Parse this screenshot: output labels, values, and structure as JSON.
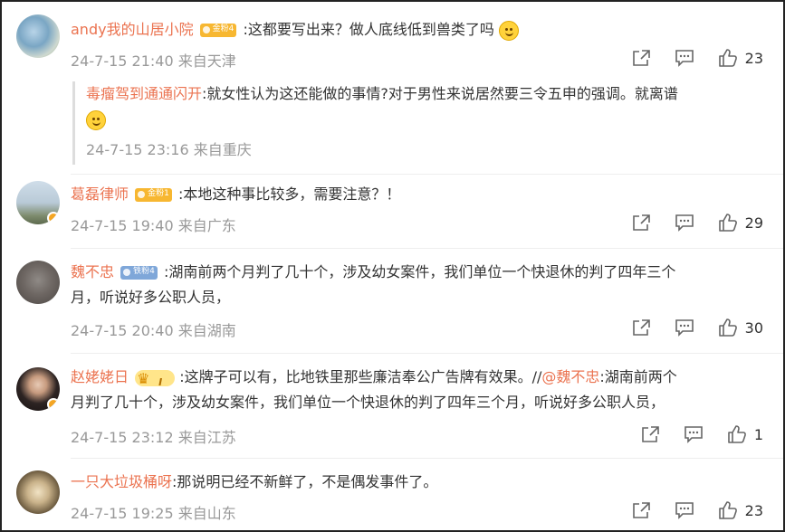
{
  "comments": [
    {
      "name": "andy我的山居小院",
      "badge": "金粉4",
      "text": ":这都要写出来？做人底线低到兽类了吗",
      "time": "24-7-15 21:40 来自天津",
      "likes": "23"
    },
    {
      "name": "毒瘤驾到通通闪开",
      "text": ":就女性认为这还能做的事情?对于男性来说居然要三令五申的强调。就离谱",
      "time": "24-7-15 23:16 来自重庆"
    },
    {
      "name": "葛磊律师",
      "badge": "金粉1",
      "text": ":本地这种事比较多，需要注意？！",
      "time": "24-7-15 19:40 来自广东",
      "likes": "29"
    },
    {
      "name": "魏不忠",
      "badge": "铁粉4",
      "text1": ":湖南前两个月判了几十个，涉及幼女案件，我们单位一个快退休的判了四年三个",
      "text2": "月，听说好多公职人员，",
      "time": "24-7-15 20:40 来自湖南",
      "likes": "30"
    },
    {
      "name": "赵姥姥日",
      "text1": ":这牌子可以有，比地铁里那些廉洁奉公广告牌有效果。//",
      "mention": "@魏不忠",
      "text1b": ":湖南前两个",
      "text2": "月判了几十个，涉及幼女案件，我们单位一个快退休的判了四年三个月，听说好多公职人员，",
      "time": "24-7-15 23:12 来自江苏",
      "likes": "1"
    },
    {
      "name": "一只大垃圾桶呀",
      "text": ":那说明已经不新鲜了，不是偶发事件了。",
      "time": "24-7-15 19:25 来自山东",
      "likes": "23"
    }
  ],
  "icons": {
    "share": "share-icon",
    "comment": "comment-icon",
    "like": "like-icon"
  },
  "colors": {
    "name": "#eb7350",
    "meta": "#999999",
    "text": "#333333"
  }
}
